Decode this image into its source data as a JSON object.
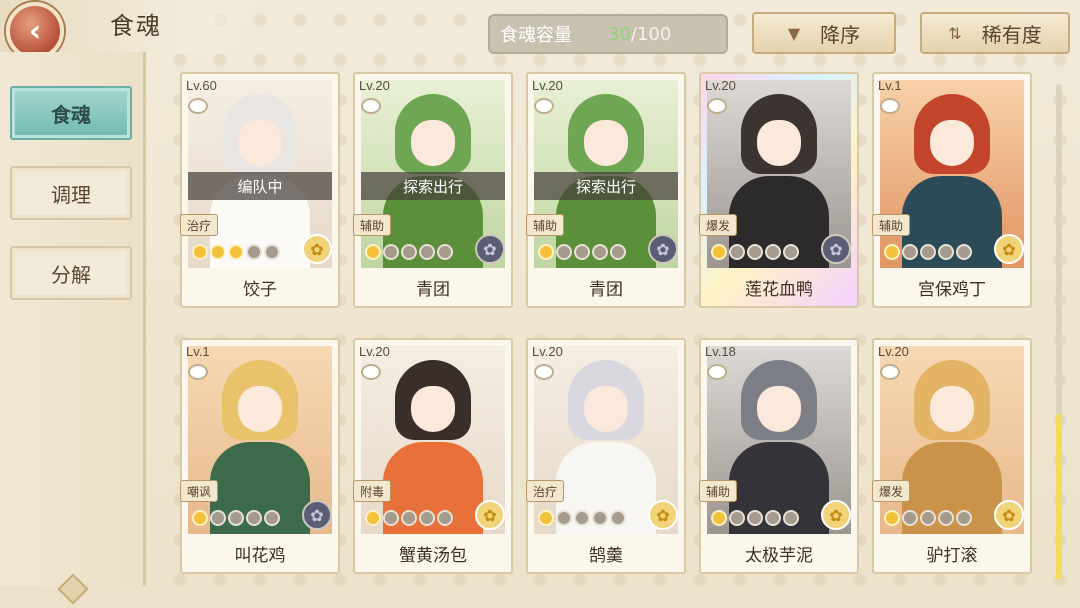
{
  "header": {
    "title": "食魂",
    "back_icon": "back-arrow-icon"
  },
  "capacity": {
    "label": "食魂容量",
    "current": "30",
    "max": "/100"
  },
  "sort_buttons": {
    "order": "降序",
    "rarity": "稀有度"
  },
  "sidebar": {
    "items": [
      {
        "label": "食魂"
      },
      {
        "label": "调理"
      },
      {
        "label": "分解"
      }
    ]
  },
  "cards": [
    {
      "level": "Lv.60",
      "name": "饺子",
      "status": "编队中",
      "role": "治疗",
      "stars": 3,
      "emblem": "gold"
    },
    {
      "level": "Lv.20",
      "name": "青团",
      "status": "探索出行",
      "role": "辅助",
      "stars": 1,
      "emblem": "dark"
    },
    {
      "level": "Lv.20",
      "name": "青团",
      "status": "探索出行",
      "role": "辅助",
      "stars": 1,
      "emblem": "dark"
    },
    {
      "level": "Lv.20",
      "name": "莲花血鸭",
      "status": "",
      "role": "爆发",
      "stars": 1,
      "emblem": "dark"
    },
    {
      "level": "Lv.1",
      "name": "宫保鸡丁",
      "status": "",
      "role": "辅助",
      "stars": 1,
      "emblem": "gold"
    },
    {
      "level": "Lv.1",
      "name": "叫花鸡",
      "status": "",
      "role": "嘲讽",
      "stars": 1,
      "emblem": "dark"
    },
    {
      "level": "Lv.20",
      "name": "蟹黄汤包",
      "status": "",
      "role": "附毒",
      "stars": 1,
      "emblem": "gold"
    },
    {
      "level": "Lv.20",
      "name": "鹄羹",
      "status": "",
      "role": "治疗",
      "stars": 1,
      "emblem": "gold"
    },
    {
      "level": "Lv.18",
      "name": "太极芋泥",
      "status": "",
      "role": "辅助",
      "stars": 1,
      "emblem": "gold"
    },
    {
      "level": "Lv.20",
      "name": "驴打滚",
      "status": "",
      "role": "爆发",
      "stars": 1,
      "emblem": "gold"
    }
  ],
  "colors": {
    "accent_teal": "#72b9b1",
    "star_gold": "#f3c23a",
    "capacity_green": "#8fd27a"
  }
}
